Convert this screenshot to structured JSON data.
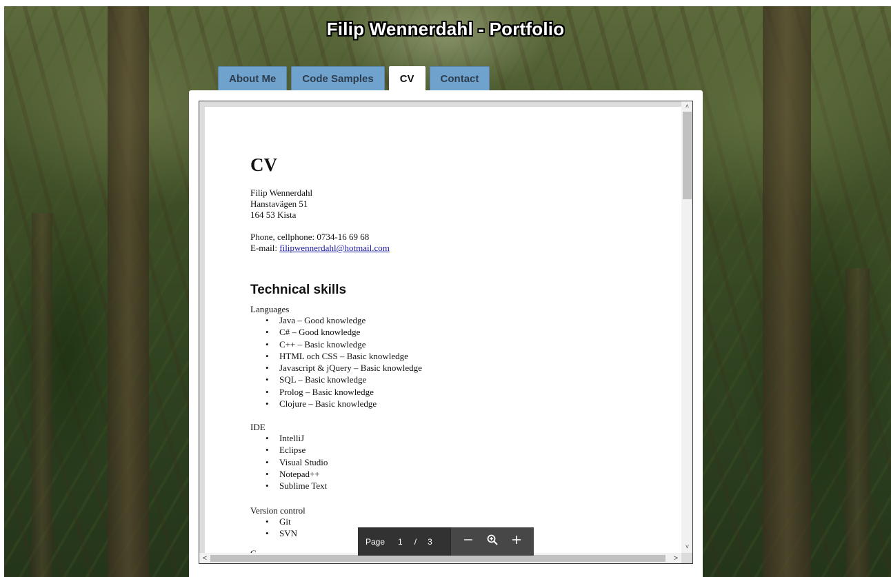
{
  "site_title": "Filip Wennerdahl - Portfolio",
  "tabs": [
    {
      "label": "About Me",
      "active": false
    },
    {
      "label": "Code Samples",
      "active": false
    },
    {
      "label": "CV",
      "active": true
    },
    {
      "label": "Contact",
      "active": false
    }
  ],
  "cv": {
    "heading": "CV",
    "name": "Filip Wennerdahl",
    "street": "Hanstavägen 51",
    "city": "164 53 Kista",
    "phone": "Phone, cellphone: 0734-16 69 68",
    "email_label": "E-mail: ",
    "email": "filipwennerdahl@hotmail.com",
    "section_title": "Technical skills",
    "languages_label": "Languages",
    "languages": [
      "Java – Good knowledge",
      "C# – Good knowledge",
      "C++ – Basic knowledge",
      "HTML och CSS – Basic knowledge",
      "Javascript & jQuery – Basic knowledge",
      "SQL – Basic knowledge",
      "Prolog – Basic knowledge",
      "Clojure – Basic knowledge"
    ],
    "ide_label": "IDE",
    "ides": [
      "IntelliJ",
      "Eclipse",
      "Visual Studio",
      "Notepad++",
      "Sublime Text"
    ],
    "vcs_label": "Version control",
    "vcs": [
      "Git",
      "SVN"
    ],
    "cutoff_text": "C"
  },
  "pdf_toolbar": {
    "page_label": "Page",
    "current_page": "1",
    "separator": "/",
    "total_pages": "3",
    "zoom_out_icon": "minus-icon",
    "zoom_icon": "magnifier-icon",
    "zoom_in_icon": "plus-icon"
  },
  "scrollbars": {
    "up_arrow": "˄",
    "down_arrow": "˅",
    "left_arrow": "<",
    "right_arrow": ">"
  }
}
